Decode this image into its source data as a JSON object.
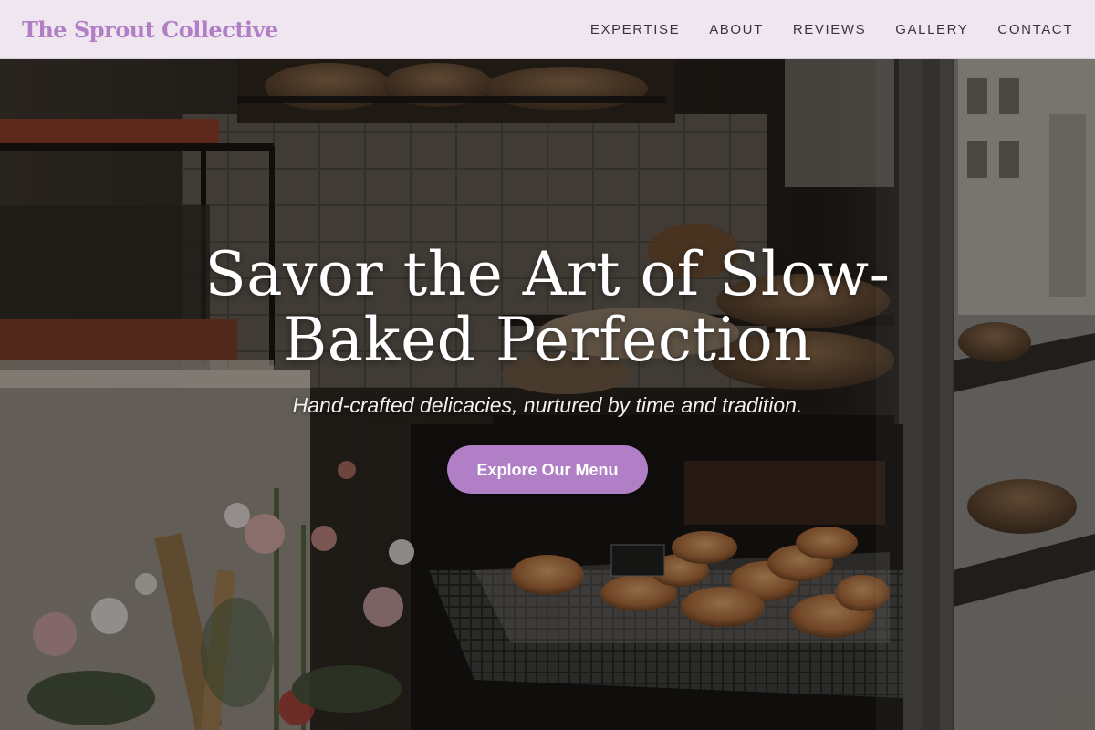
{
  "nav": {
    "brand": "The Sprout Collective",
    "links": [
      "EXPERTISE",
      "ABOUT",
      "REVIEWS",
      "GALLERY",
      "CONTACT"
    ]
  },
  "hero": {
    "title": "Savor the Art of Slow-Baked Perfection",
    "subtitle": "Hand-crafted delicacies, nurtured by time and tradition.",
    "cta_label": "Explore Our Menu"
  },
  "colors": {
    "accent": "#b07fc6",
    "nav_background": "#efe6ef",
    "nav_text": "#3b3340",
    "hero_text": "#ffffff"
  }
}
